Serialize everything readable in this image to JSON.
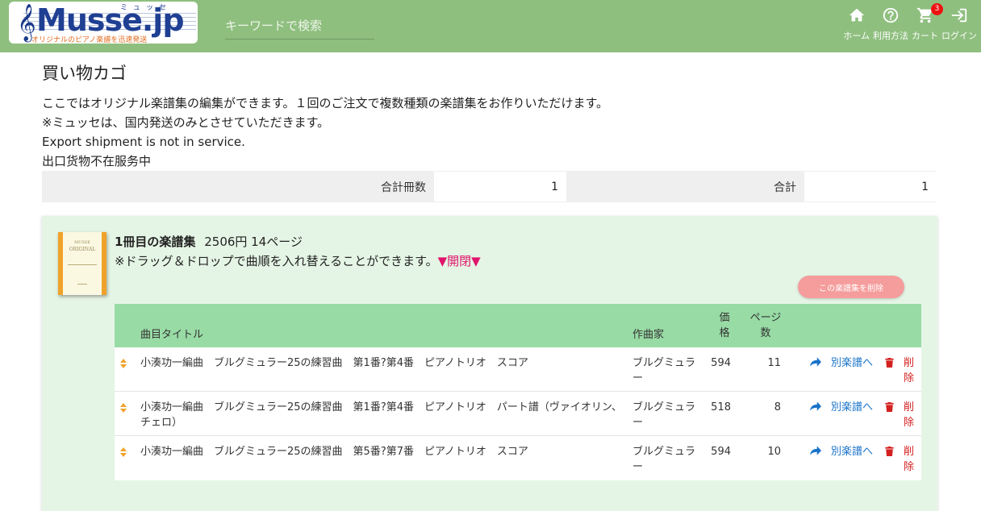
{
  "header": {
    "logo": {
      "text": "Musse.jp",
      "kana": "ミュッセ",
      "tagline": "オリジナルのピアノ楽譜を迅速発送"
    },
    "search_placeholder": "キーワードで検索",
    "nav": [
      {
        "label": "ホーム",
        "icon": "home-icon"
      },
      {
        "label": "利用方法",
        "icon": "help-icon"
      },
      {
        "label": "カート",
        "icon": "cart-icon",
        "badge": "3"
      },
      {
        "label": "ログイン",
        "icon": "login-icon"
      }
    ]
  },
  "page": {
    "title": "買い物カゴ",
    "intro": [
      "ここではオリジナル楽譜集の編集ができます。１回のご注文で複数種類の楽譜集をお作りいただけます。",
      "※ミュッセは、国内発送のみとさせていただきます。",
      "Export shipment is not in service.",
      "出口货物不在服务中"
    ]
  },
  "totals": {
    "count_label": "合計冊数",
    "count_value": "1",
    "sum_label": "合計",
    "sum_value": "1"
  },
  "book": {
    "thumb": {
      "line1": "MUSSE",
      "line2": "ORIGINAL"
    },
    "name": "1冊目の楽譜集",
    "price_pages": "2506円 14ページ",
    "note": "※ドラッグ＆ドロップで曲順を入れ替えることができます。",
    "toggle": "▼開閉▼",
    "delete_button": "この楽譜集を削除",
    "columns": {
      "title": "曲目タイトル",
      "composer": "作曲家",
      "price": "価格",
      "pages": "ページ数"
    },
    "items": [
      {
        "title": "小湊功一編曲　ブルグミュラー25の練習曲　第1番?第4番　ピアノトリオ　スコア",
        "composer": "ブルグミュラー",
        "price": "594",
        "pages": "11",
        "move": "別楽譜へ",
        "delete": "削除"
      },
      {
        "title": "小湊功一編曲　ブルグミュラー25の練習曲　第1番?第4番　ピアノトリオ　パート譜（ヴァイオリン、チェロ）",
        "composer": "ブルグミュラー",
        "price": "518",
        "pages": "8",
        "move": "別楽譜へ",
        "delete": "削除"
      },
      {
        "title": "小湊功一編曲　ブルグミュラー25の練習曲　第5番?第7番　ピアノトリオ　スコア",
        "composer": "ブルグミュラー",
        "price": "594",
        "pages": "10",
        "move": "別楽譜へ",
        "delete": "削除"
      }
    ]
  },
  "colors": {
    "header": "#8fbf7f",
    "card": "#e5f5e5",
    "table_head": "#98dba5",
    "link": "#1a73c9",
    "danger": "#d42020",
    "accent": "#e0146a",
    "delete_button": "#f59c9c"
  }
}
